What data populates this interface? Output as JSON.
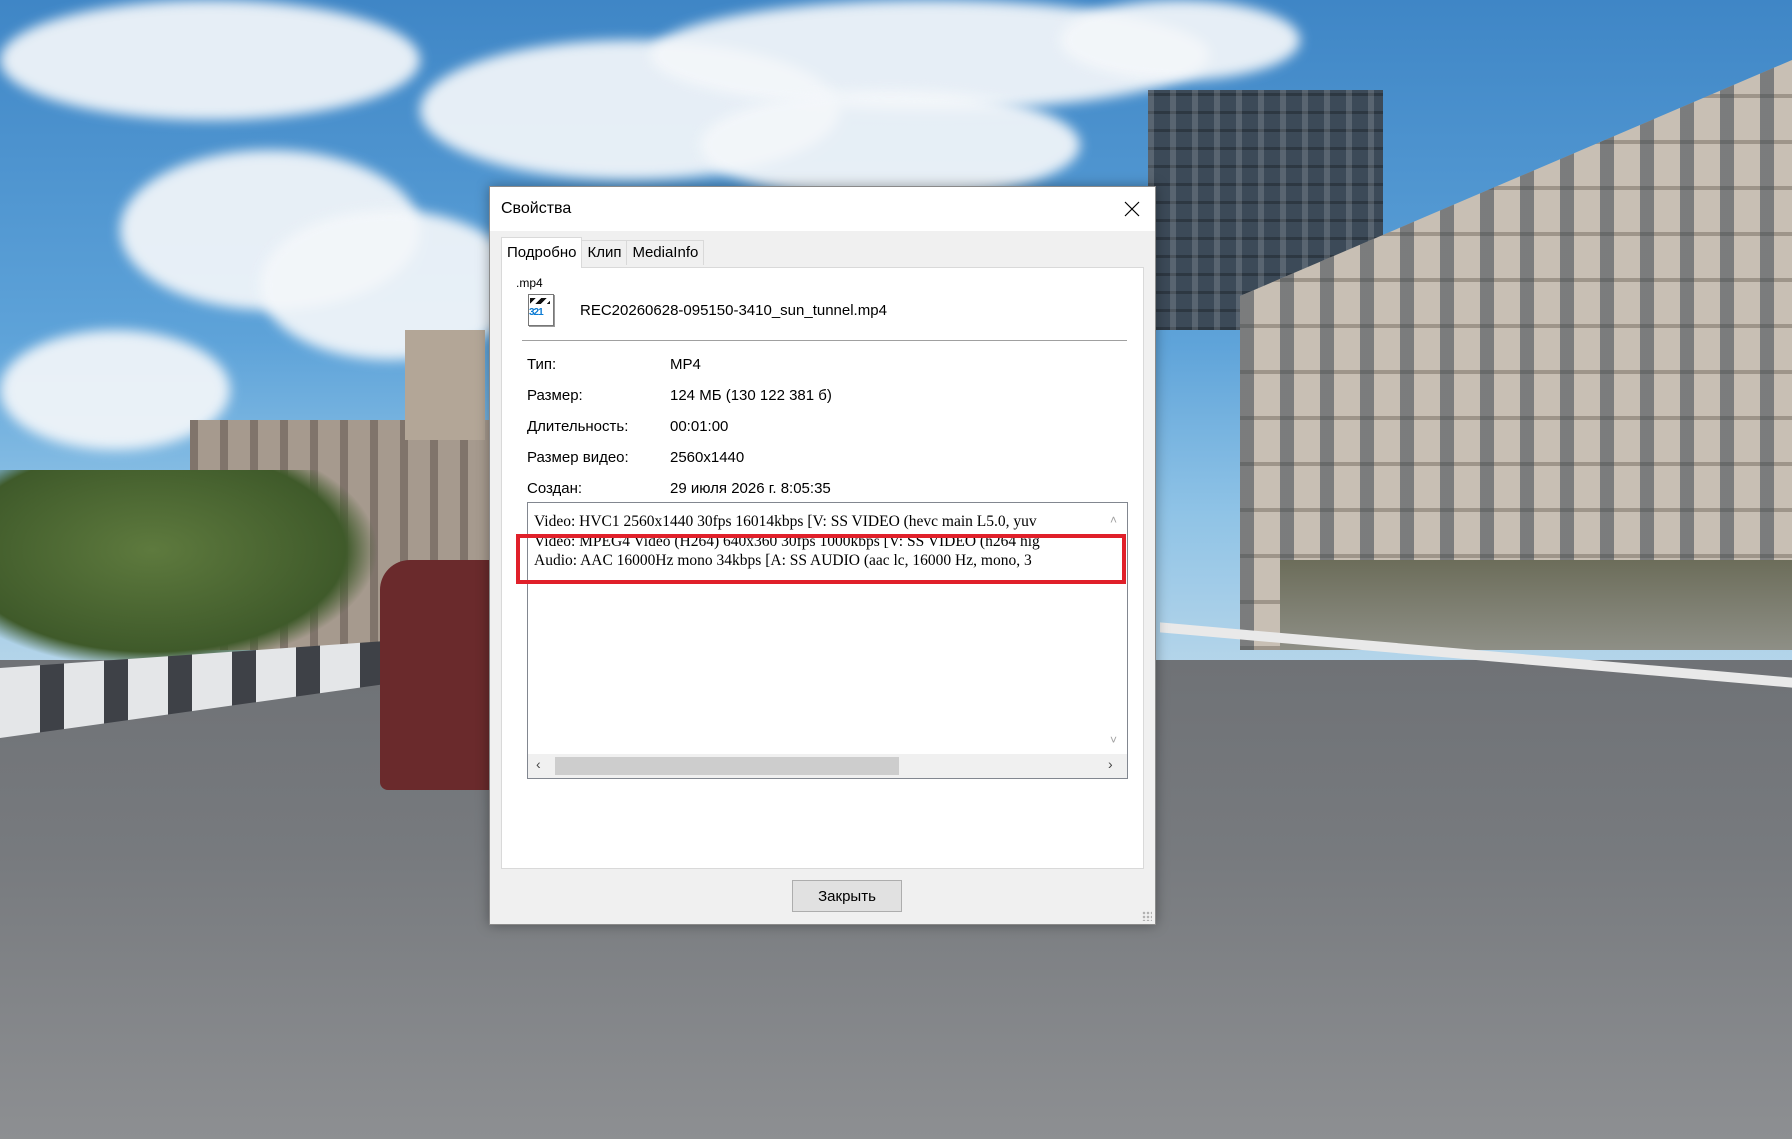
{
  "dialog": {
    "title": "Свойства",
    "close_glyph": "close-icon",
    "tabs": [
      {
        "label": "Подробно",
        "active": true
      },
      {
        "label": "Клип",
        "active": false
      },
      {
        "label": "MediaInfo",
        "active": false
      }
    ],
    "file": {
      "extension": ".mp4",
      "icon_number": "321",
      "name": "REC20260628-095150-3410_sun_tunnel.mp4"
    },
    "properties": [
      {
        "label": "Тип:",
        "value": "MP4"
      },
      {
        "label": "Размер:",
        "value": "124 МБ (130 122 381 б)"
      },
      {
        "label": "Длительность:",
        "value": "00:01:00"
      },
      {
        "label": "Размер видео:",
        "value": "2560x1440"
      },
      {
        "label": "Создан:",
        "value": "29 июля 2026 г. 8:05:35"
      }
    ],
    "mediainfo_lines": [
      "Video: HVC1 2560x1440 30fps 16014kbps [V: SS VIDEO (hevc main L5.0, yuv",
      "Video: MPEG4 Video (H264) 640x360 30fps 1000kbps [V: SS VIDEO (h264 hig",
      "Audio: AAC 16000Hz mono 34kbps [A: SS AUDIO (aac lc, 16000 Hz, mono, 3"
    ],
    "close_button": "Закрыть"
  },
  "colors": {
    "highlight": "#e0202a",
    "dialog_bg": "#f0f0f0"
  }
}
